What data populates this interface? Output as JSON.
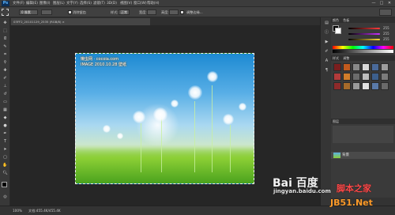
{
  "menubar": {
    "logo": "Ps",
    "items": [
      "文件(F)",
      "编辑(E)",
      "图像(I)",
      "图层(L)",
      "文字(Y)",
      "选择(S)",
      "滤镜(T)",
      "3D(D)",
      "视图(V)",
      "窗口(W)",
      "帮助(H)"
    ],
    "window_controls": [
      "—",
      "□",
      "✕"
    ]
  },
  "options_bar": {
    "tool_icon": "marquee-icon",
    "feather_value": "0 像素",
    "style_label": "样式:",
    "style_value": "正常",
    "width_label": "宽度:",
    "height_label": "高度:",
    "adjust_edge": "调整边缘...",
    "anti_alias_label": "消除锯齿"
  },
  "document": {
    "tab_title": "03FF2_20101129_2535 (RGB/8) ×"
  },
  "image": {
    "watermark_line1": "懒虫网 · cocoia.com",
    "watermark_line2": "IMAGE 2010.10.28 壁纸"
  },
  "panels": {
    "color_tab": "颜色",
    "swatch_tab": "色板",
    "styles_tab": "样式",
    "adjust_tab": "调整",
    "layers_tab": "图层",
    "r_value": "255",
    "g_value": "255",
    "b_value": "255",
    "layer_name": "背景"
  },
  "status": {
    "zoom": "100%",
    "doc_info": "文档:455.4K/455.4K"
  },
  "credits": {
    "baidu": "Bai 百度",
    "jingyan": "jingyan.baidu.com",
    "site1": "脚本之家",
    "site2": "JB51.Net"
  }
}
